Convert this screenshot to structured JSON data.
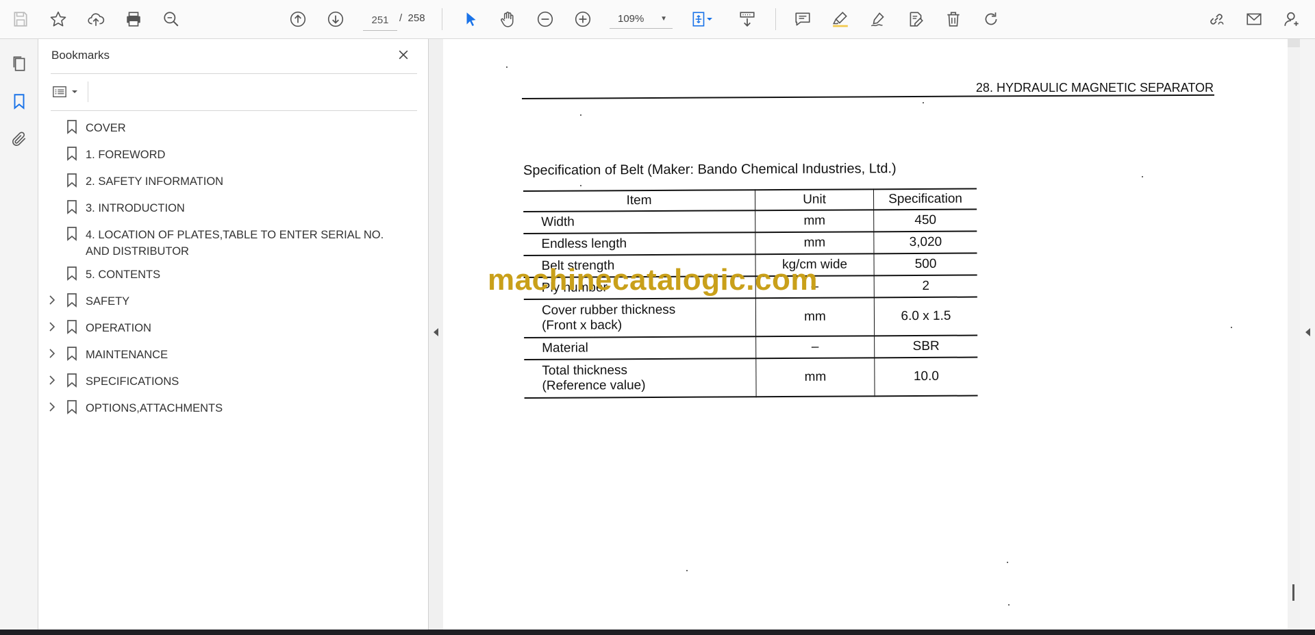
{
  "toolbar": {
    "current_page": "251",
    "page_separator": "/",
    "total_pages": "258",
    "zoom": "109%"
  },
  "bookmarks_panel": {
    "title": "Bookmarks",
    "items": [
      {
        "label": "COVER",
        "expandable": false
      },
      {
        "label": "1. FOREWORD",
        "expandable": false
      },
      {
        "label": "2. SAFETY INFORMATION",
        "expandable": false
      },
      {
        "label": "3. INTRODUCTION",
        "expandable": false
      },
      {
        "label": "4. LOCATION OF PLATES,TABLE TO ENTER SERIAL NO. AND DISTRIBUTOR",
        "expandable": false
      },
      {
        "label": "5. CONTENTS",
        "expandable": false
      },
      {
        "label": "SAFETY",
        "expandable": true
      },
      {
        "label": "OPERATION",
        "expandable": true
      },
      {
        "label": "MAINTENANCE",
        "expandable": true
      },
      {
        "label": "SPECIFICATIONS",
        "expandable": true
      },
      {
        "label": "OPTIONS,ATTACHMENTS",
        "expandable": true
      }
    ]
  },
  "document": {
    "header": "28. HYDRAULIC MAGNETIC SEPARATOR",
    "spec_title": "Specification of Belt (Maker: Bando Chemical Industries, Ltd.)",
    "table": {
      "headers": [
        "Item",
        "Unit",
        "Specification"
      ],
      "rows": [
        {
          "item": "Width",
          "item2": "",
          "unit": "mm",
          "spec": "450"
        },
        {
          "item": "Endless length",
          "item2": "",
          "unit": "mm",
          "spec": "3,020"
        },
        {
          "item": "Belt strength",
          "item2": "",
          "unit": "kg/cm wide",
          "spec": "500"
        },
        {
          "item": "Ply number",
          "item2": "",
          "unit": "–",
          "spec": "2"
        },
        {
          "item": "Cover rubber thickness",
          "item2": "(Front x back)",
          "unit": "mm",
          "spec": "6.0 x 1.5"
        },
        {
          "item": "Material",
          "item2": "",
          "unit": "–",
          "spec": "SBR"
        },
        {
          "item": "Total thickness",
          "item2": "(Reference value)",
          "unit": "mm",
          "spec": "10.0"
        }
      ]
    },
    "watermark": "machinecatalogic.com"
  },
  "colors": {
    "accent": "#1a73e8",
    "watermark": "#c9a01a"
  }
}
